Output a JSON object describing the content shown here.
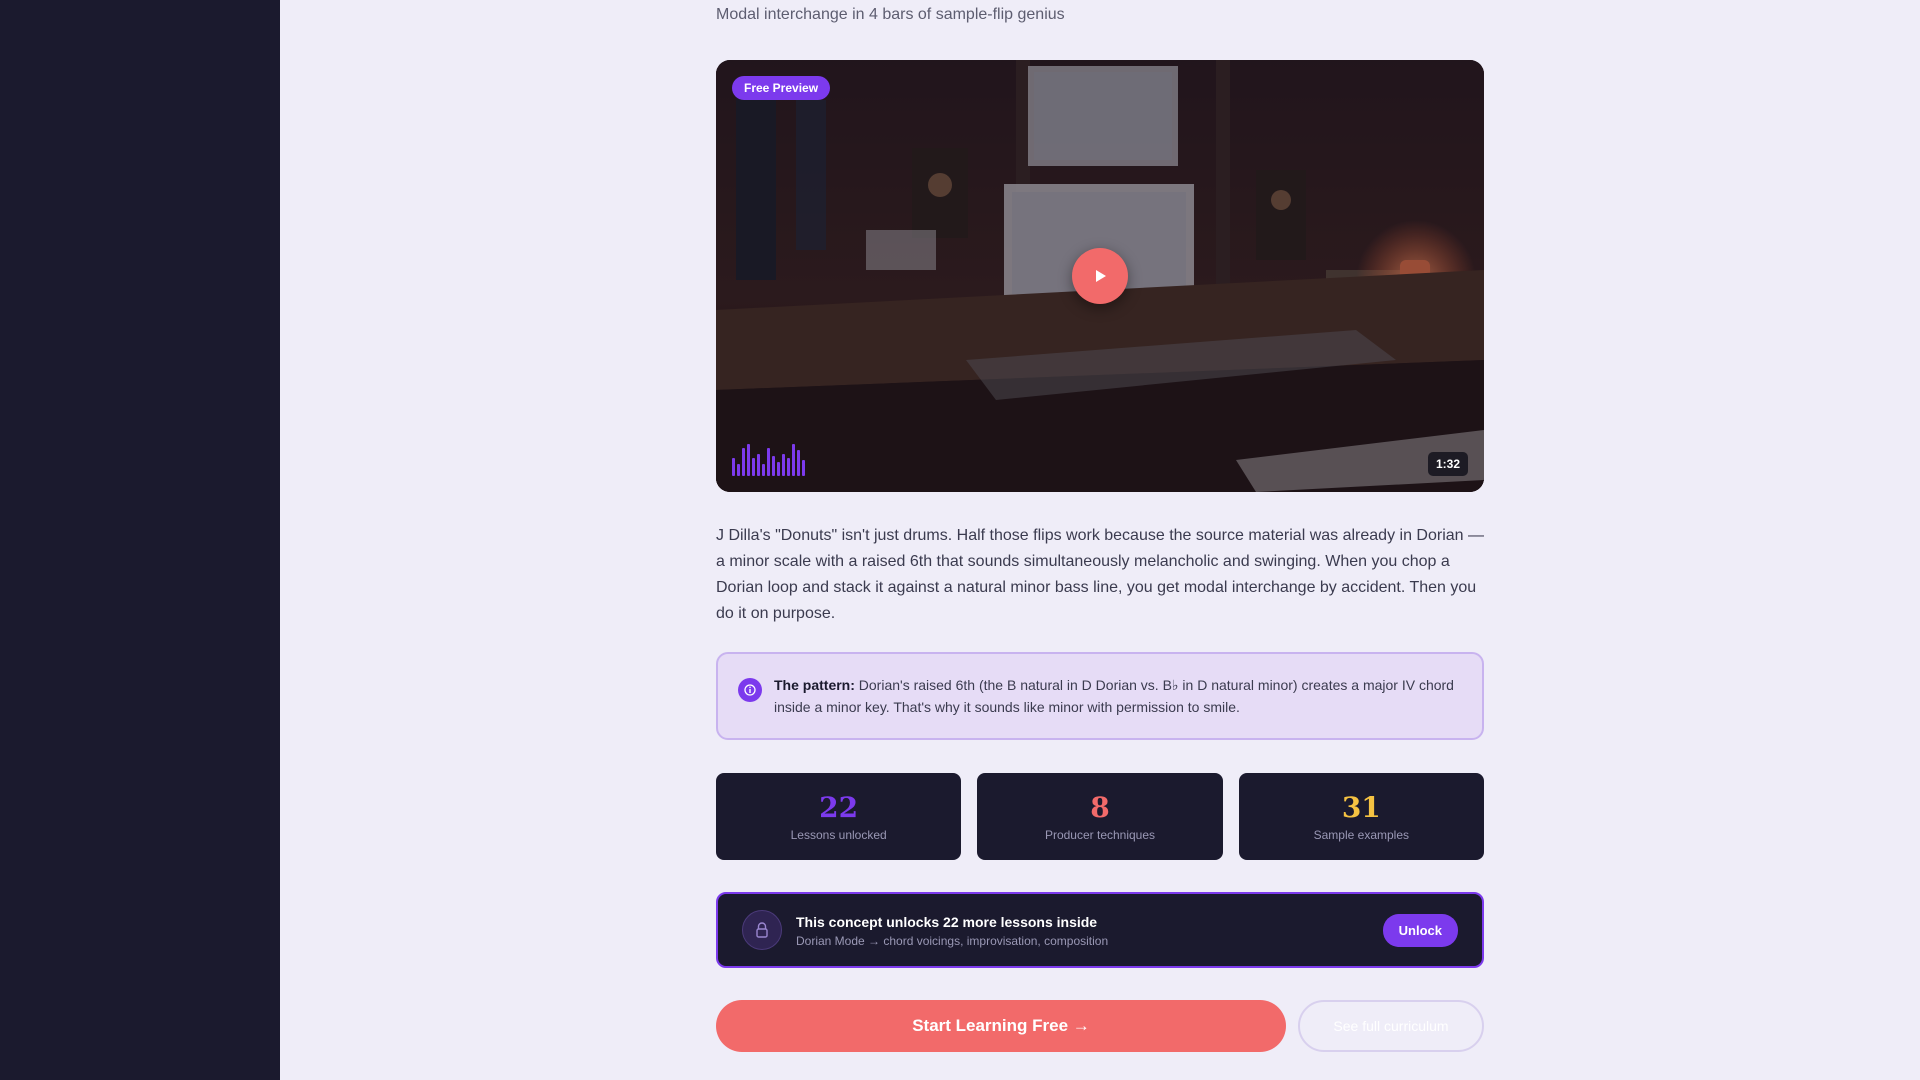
{
  "lesson": {
    "subtitle": "Modal interchange in 4 bars of sample-flip genius"
  },
  "video": {
    "badge": "Free Preview",
    "duration": "1:32",
    "waveform_levels": [
      0.45,
      0.3,
      0.7,
      0.8,
      0.45,
      0.55,
      0.3,
      0.7,
      0.5,
      0.35,
      0.55,
      0.45,
      0.8,
      0.65,
      0.4
    ]
  },
  "body": {
    "paragraph": "J Dilla's \"Donuts\" isn't just drums. Half those flips work because the source material was already in Dorian — a minor scale with a raised 6th that sounds simultaneously melancholic and swinging. When you chop a Dorian loop and stack it against a natural minor bass line, you get modal interchange by accident. Then you do it on purpose."
  },
  "callout": {
    "label": "The pattern:",
    "text": "Dorian's raised 6th (the B natural in D Dorian vs. B♭ in D natural minor) creates a major IV chord inside a minor key. That's why it sounds like minor with permission to smile."
  },
  "stats": [
    {
      "value": "22",
      "label": "Lessons unlocked",
      "color": "#7c3aed"
    },
    {
      "value": "8",
      "label": "Producer techniques",
      "color": "#f26a6a"
    },
    {
      "value": "31",
      "label": "Sample examples",
      "color": "#f5c242"
    }
  ],
  "unlock": {
    "title": "This concept unlocks 22 more lessons inside",
    "subtitle": "Dorian Mode → chord voicings, improvisation, composition",
    "button": "Unlock"
  },
  "actions": {
    "primary": "Start Learning Free →",
    "secondary": "See full curriculum"
  },
  "colors": {
    "accent": "#7c3aed",
    "coral": "#f26a6a",
    "gold": "#f5c242",
    "dark": "#1b1a2e",
    "background": "#efedf8"
  }
}
